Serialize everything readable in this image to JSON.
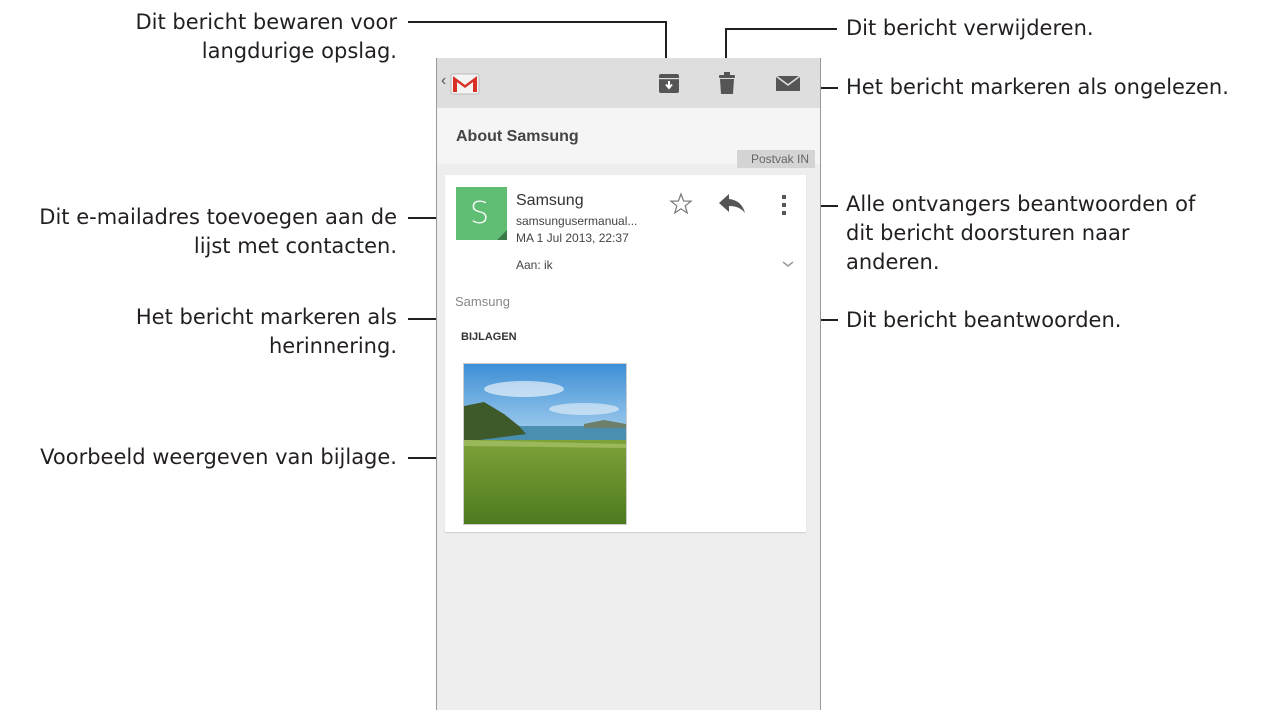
{
  "app": {
    "back": "‹",
    "subject": "About Samsung",
    "label": "Postvak IN",
    "icons": {
      "archive": "archive-icon",
      "delete": "trash-icon",
      "mark_unread": "envelope-icon",
      "star": "star-icon",
      "reply": "reply-icon",
      "more": "more-vert-icon",
      "expand": "chevron-down-icon"
    }
  },
  "message": {
    "avatar_letter": "S",
    "sender": "Samsung",
    "address": "samsungusermanual...",
    "date": "MA 1 Jul 2013, 22:37",
    "to": "Aan: ik",
    "snippet": "Samsung",
    "attachments_header": "BIJLAGEN"
  },
  "annotations": {
    "archive": [
      "Dit bericht bewaren voor",
      "langdurige opslag."
    ],
    "delete": [
      "Dit bericht verwijderen."
    ],
    "mark_unread": [
      "Het bericht markeren als ongelezen."
    ],
    "add_contact": [
      "Dit e-mailadres toevoegen aan de",
      "lijst met contacten."
    ],
    "reply_all_forward": [
      "Alle ontvangers beantwoorden of",
      "dit bericht doorsturen naar",
      "anderen."
    ],
    "star": [
      "Het bericht markeren als",
      "herinnering."
    ],
    "reply": [
      "Dit bericht beantwoorden."
    ],
    "preview": [
      "Voorbeeld weergeven van bijlage."
    ]
  },
  "colors": {
    "avatar": "#5fbd74",
    "gmail_red": "#d93025",
    "topbar": "#dedede",
    "icons": "#555555"
  }
}
